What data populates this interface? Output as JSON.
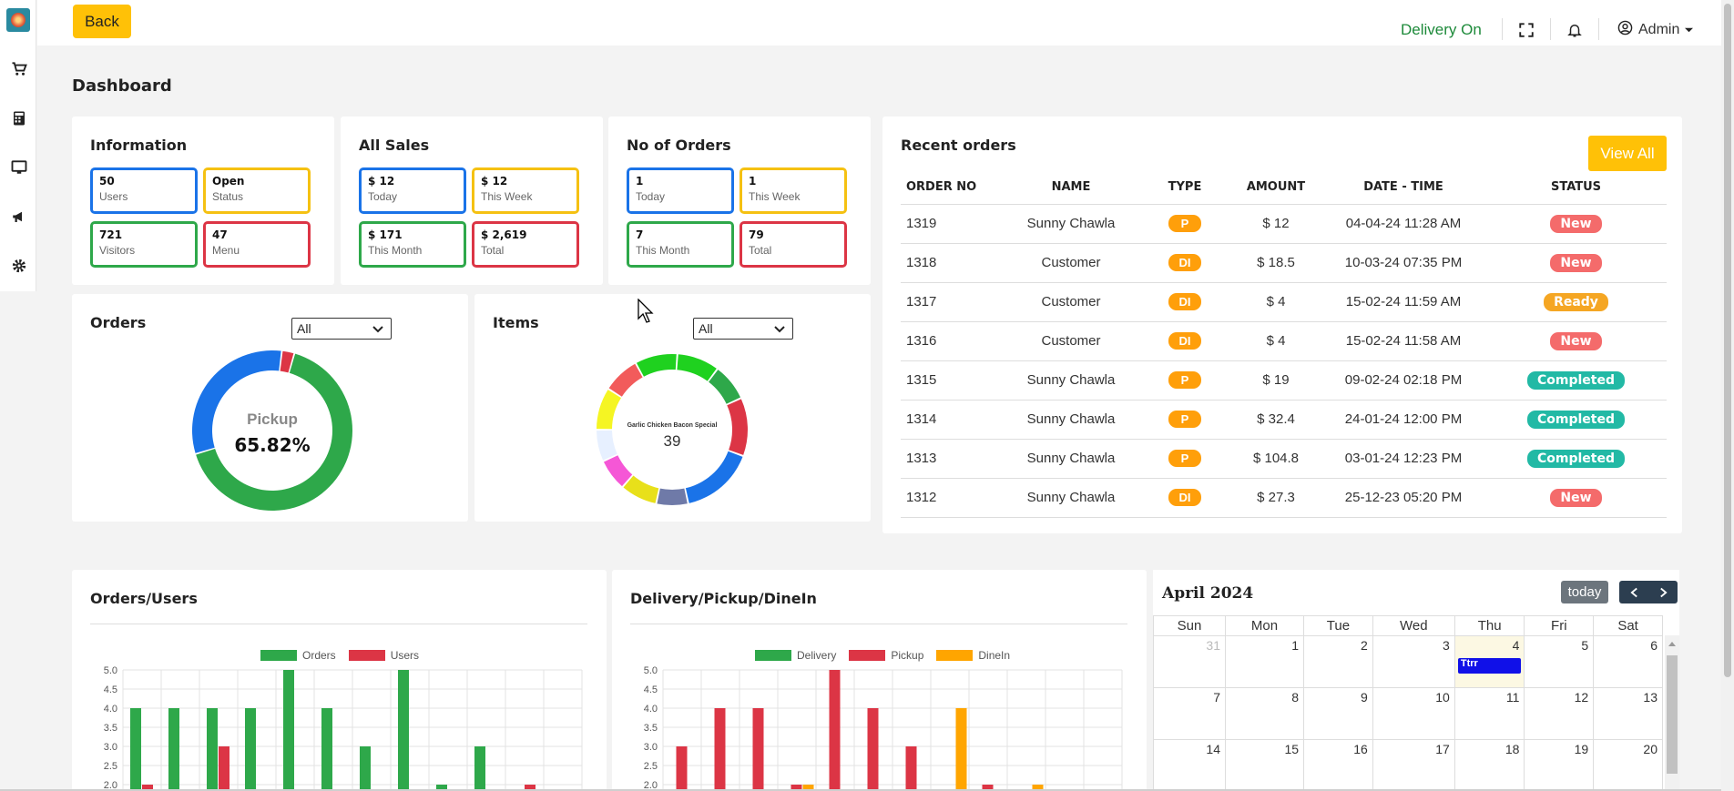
{
  "header": {
    "back_label": "Back",
    "delivery_status": "Delivery On",
    "admin_label": "Admin",
    "status_color": "#1d8a3a"
  },
  "sidebar": {
    "icons": [
      "logo",
      "cart-icon",
      "calculator-icon",
      "monitor-icon",
      "megaphone-icon",
      "gear-icon"
    ]
  },
  "page_title": "Dashboard",
  "information": {
    "title": "Information",
    "stats": [
      {
        "value": "50",
        "label": "Users"
      },
      {
        "value": "Open",
        "label": "Status"
      },
      {
        "value": "721",
        "label": "Visitors"
      },
      {
        "value": "47",
        "label": "Menu"
      }
    ]
  },
  "all_sales": {
    "title": "All Sales",
    "stats": [
      {
        "value": "$ 12",
        "label": "Today"
      },
      {
        "value": "$ 12",
        "label": "This Week"
      },
      {
        "value": "$ 171",
        "label": "This Month"
      },
      {
        "value": "$ 2,619",
        "label": "Total"
      }
    ]
  },
  "no_of_orders": {
    "title": "No of Orders",
    "stats": [
      {
        "value": "1",
        "label": "Today"
      },
      {
        "value": "1",
        "label": "This Week"
      },
      {
        "value": "7",
        "label": "This Month"
      },
      {
        "value": "79",
        "label": "Total"
      }
    ]
  },
  "orders_card": {
    "title": "Orders",
    "filter": "All",
    "center_label": "Pickup",
    "center_value": "65.82%"
  },
  "items_card": {
    "title": "Items",
    "filter": "All",
    "center_label": "Garlic Chicken Bacon Special",
    "center_value": "39"
  },
  "recent_orders": {
    "title": "Recent orders",
    "view_all": "View All",
    "columns": [
      "ORDER NO",
      "NAME",
      "TYPE",
      "AMOUNT",
      "DATE - TIME",
      "STATUS"
    ],
    "rows": [
      {
        "order_no": "1319",
        "name": "Sunny Chawla",
        "type": "P",
        "amount": "$ 12",
        "datetime": "04-04-24 11:28 AM",
        "status": "New"
      },
      {
        "order_no": "1318",
        "name": "Customer",
        "type": "DI",
        "amount": "$ 18.5",
        "datetime": "10-03-24 07:35 PM",
        "status": "New"
      },
      {
        "order_no": "1317",
        "name": "Customer",
        "type": "DI",
        "amount": "$ 4",
        "datetime": "15-02-24 11:59 AM",
        "status": "Ready"
      },
      {
        "order_no": "1316",
        "name": "Customer",
        "type": "DI",
        "amount": "$ 4",
        "datetime": "15-02-24 11:58 AM",
        "status": "New"
      },
      {
        "order_no": "1315",
        "name": "Sunny Chawla",
        "type": "P",
        "amount": "$ 19",
        "datetime": "09-02-24 02:18 PM",
        "status": "Completed"
      },
      {
        "order_no": "1314",
        "name": "Sunny Chawla",
        "type": "P",
        "amount": "$ 32.4",
        "datetime": "24-01-24 12:00 PM",
        "status": "Completed"
      },
      {
        "order_no": "1313",
        "name": "Sunny Chawla",
        "type": "P",
        "amount": "$ 104.8",
        "datetime": "03-01-24 12:23 PM",
        "status": "Completed"
      },
      {
        "order_no": "1312",
        "name": "Sunny Chawla",
        "type": "DI",
        "amount": "$ 27.3",
        "datetime": "25-12-23 05:20 PM",
        "status": "New"
      }
    ]
  },
  "calendar": {
    "title": "April 2024",
    "today_label": "today",
    "weekdays": [
      "Sun",
      "Mon",
      "Tue",
      "Wed",
      "Thu",
      "Fri",
      "Sat"
    ],
    "weeks": [
      [
        "31",
        "1",
        "2",
        "3",
        "4",
        "5",
        "6"
      ],
      [
        "7",
        "8",
        "9",
        "10",
        "11",
        "12",
        "13"
      ],
      [
        "14",
        "15",
        "16",
        "17",
        "18",
        "19",
        "20"
      ]
    ],
    "event": {
      "day": "4",
      "label": "Ttrr",
      "color": "#1010e8"
    }
  },
  "chart_data": [
    {
      "type": "pie",
      "title": "Orders",
      "center_label": "Pickup",
      "center_value": "65.82%",
      "values": [
        65.82,
        31.65,
        2.53
      ],
      "colors": [
        "#2ea84a",
        "#1a73e8",
        "#dc3545"
      ]
    },
    {
      "type": "pie",
      "title": "Items",
      "center_label": "Garlic Chicken Bacon Special",
      "center_value": "39",
      "values": [
        8,
        7,
        11,
        14,
        6,
        7,
        6,
        6,
        8,
        7,
        8
      ],
      "colors": [
        "#1fd11f",
        "#2ea84a",
        "#dc3545",
        "#1a73e8",
        "#6f7aa8",
        "#e8e01a",
        "#f557d6",
        "#e7f0ff",
        "#f5f523",
        "#f25b5b",
        "#1fd11f"
      ]
    },
    {
      "type": "bar",
      "title": "Orders/Users",
      "ylim": [
        2.0,
        5.0
      ],
      "yticks": [
        "5.0",
        "4.5",
        "4.0",
        "3.5",
        "3.0",
        "2.5",
        "2.0"
      ],
      "series": [
        {
          "name": "Orders",
          "color": "#2ea84a",
          "values": [
            4,
            4,
            4,
            4,
            5,
            4,
            3,
            5,
            2,
            3,
            0,
            0
          ]
        },
        {
          "name": "Users",
          "color": "#dc3545",
          "values": [
            2,
            0,
            3,
            0,
            0,
            0,
            0,
            0,
            0,
            0,
            2,
            0
          ]
        }
      ]
    },
    {
      "type": "bar",
      "title": "Delivery/Pickup/DineIn",
      "ylim": [
        2.0,
        5.0
      ],
      "yticks": [
        "5.0",
        "4.5",
        "4.0",
        "3.5",
        "3.0",
        "2.5",
        "2.0"
      ],
      "series": [
        {
          "name": "Delivery",
          "color": "#2ea84a",
          "values": [
            0,
            0,
            0,
            0,
            0,
            0,
            0,
            0,
            0,
            0,
            0,
            0
          ]
        },
        {
          "name": "Pickup",
          "color": "#dc3545",
          "values": [
            3,
            4,
            4,
            2,
            5,
            4,
            3,
            0,
            2,
            0,
            0,
            0
          ]
        },
        {
          "name": "DineIn",
          "color": "#ffa500",
          "values": [
            0,
            0,
            0,
            2,
            0,
            0,
            0,
            4,
            0,
            2,
            0,
            0
          ]
        }
      ]
    }
  ]
}
